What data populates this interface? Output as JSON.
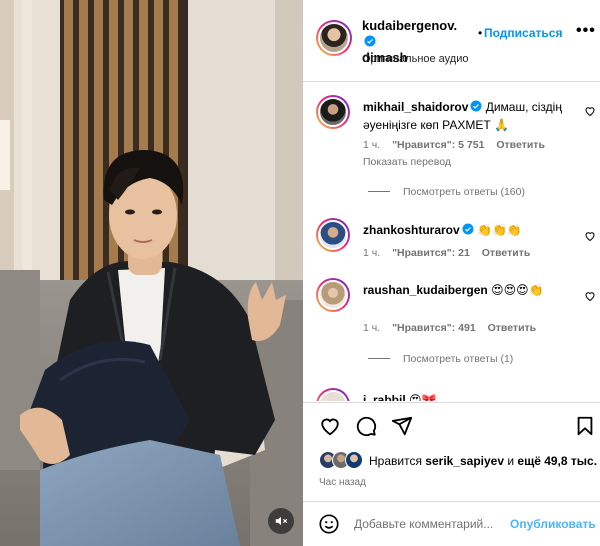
{
  "post": {
    "username_line1": "kudaibergenov.",
    "username_line2": "dimash",
    "dot": "•",
    "follow_label": "Подписаться",
    "more_label": "•••",
    "audio_label": "Оригинальное аудио"
  },
  "comments": [
    {
      "username": "mikhail_shaidorov",
      "verified": true,
      "text": "Димаш, сіздің әуеніңізге көп РАХМЕТ 🙏",
      "time": "1 ч.",
      "likes": "\"Нравится\": 5 751",
      "reply": "Ответить",
      "translate": "Показать перевод",
      "view_replies": "Посмотреть ответы (160)"
    },
    {
      "username": "zhankoshturarov",
      "verified": true,
      "text": "👏👏👏",
      "time": "1 ч.",
      "likes": "\"Нравится\": 21",
      "reply": "Ответить"
    },
    {
      "username": "raushan_kudaibergen",
      "verified": false,
      "text": "😍😍😍👏",
      "time": "1 ч.",
      "likes": "\"Нравится\": 491",
      "reply": "Ответить",
      "view_replies": "Посмотреть ответы (1)"
    },
    {
      "username": "i_rabbil",
      "verified": false,
      "text": "😍🎀"
    }
  ],
  "likes": {
    "prefix": "Нравится ",
    "user": "serik_sapiyev",
    "suffix": " и ",
    "others": "ещё 49,8 тыс."
  },
  "time_ago": "Час назад",
  "add_comment": {
    "placeholder": "Добавьте комментарий...",
    "publish_label": "Опубликовать"
  },
  "icons": {
    "like": "heart-icon",
    "comment": "comment-icon",
    "share": "paper-plane-icon",
    "save": "bookmark-icon",
    "emoji": "smiley-icon",
    "mute": "speaker-muted-icon",
    "verified": "verified-badge-icon"
  },
  "colors": {
    "accent": "#0095f6",
    "publish_disabled": "#4cb5f9",
    "verified": "#0095f6",
    "muted_text": "#737373",
    "divider": "#dbdbdb"
  }
}
